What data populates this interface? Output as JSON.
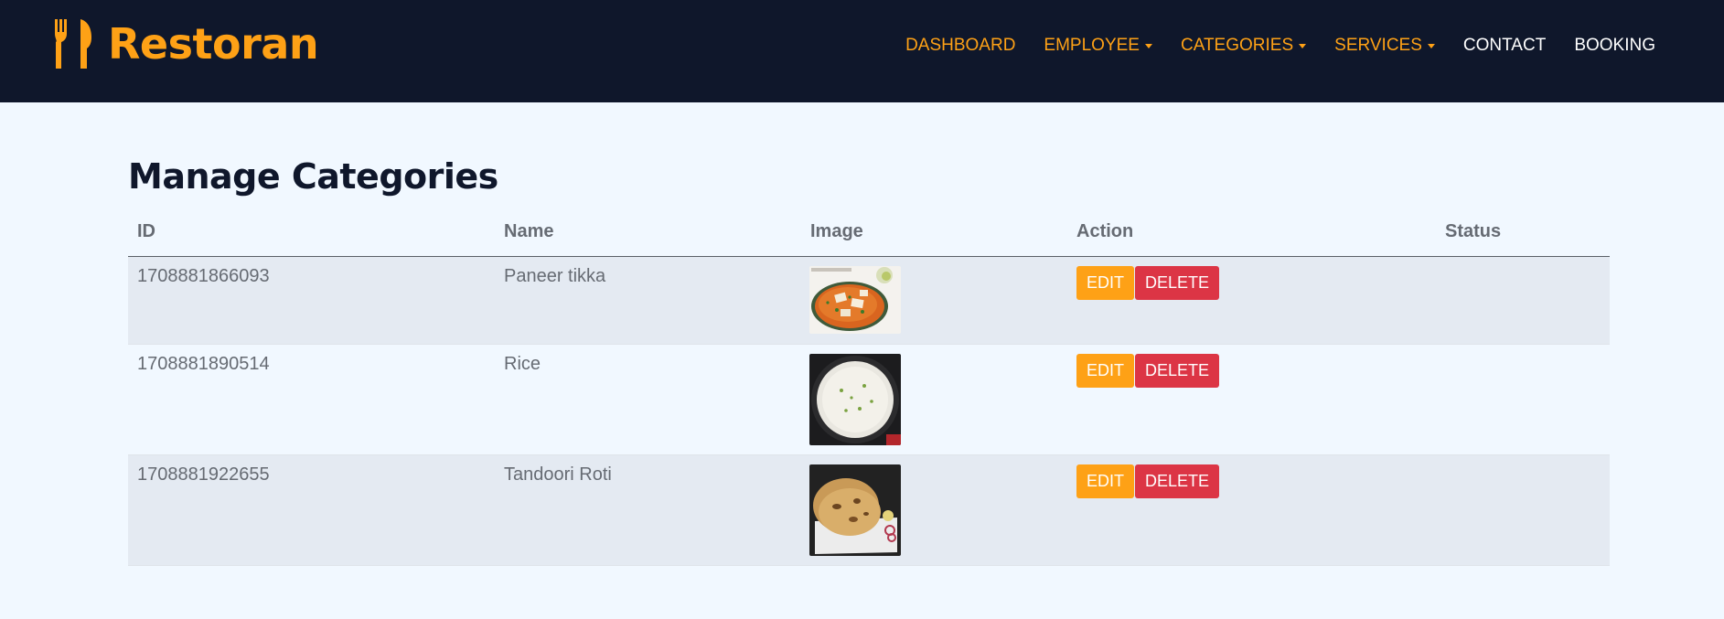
{
  "brand": {
    "name": "Restoran",
    "icon": "utensils-icon",
    "color": "#fea116"
  },
  "nav": [
    {
      "label": "DASHBOARD",
      "dropdown": false,
      "color": "#fea116"
    },
    {
      "label": "EMPLOYEE",
      "dropdown": true,
      "color": "#fea116"
    },
    {
      "label": "CATEGORIES",
      "dropdown": true,
      "color": "#fea116"
    },
    {
      "label": "SERVICES",
      "dropdown": true,
      "color": "#fea116"
    },
    {
      "label": "CONTACT",
      "dropdown": false,
      "color": "#ffffff"
    },
    {
      "label": "BOOKING",
      "dropdown": false,
      "color": "#ffffff"
    }
  ],
  "page": {
    "title": "Manage Categories"
  },
  "table": {
    "headers": {
      "id": "ID",
      "name": "Name",
      "image": "Image",
      "action": "Action",
      "status": "Status"
    },
    "rows": [
      {
        "id": "1708881866093",
        "name": "Paneer tikka",
        "image": "paneer-tikka-image",
        "edit": "EDIT",
        "delete": "DELETE",
        "status": ""
      },
      {
        "id": "1708881890514",
        "name": "Rice",
        "image": "rice-image",
        "edit": "EDIT",
        "delete": "DELETE",
        "status": ""
      },
      {
        "id": "1708881922655",
        "name": "Tandoori Roti",
        "image": "tandoori-roti-image",
        "edit": "EDIT",
        "delete": "DELETE",
        "status": ""
      }
    ]
  },
  "colors": {
    "navbar": "#0f172b",
    "accent": "#fea116",
    "danger": "#dc3545",
    "page_bg": "#f1f8ff",
    "row_alt": "#e4eaf2"
  }
}
